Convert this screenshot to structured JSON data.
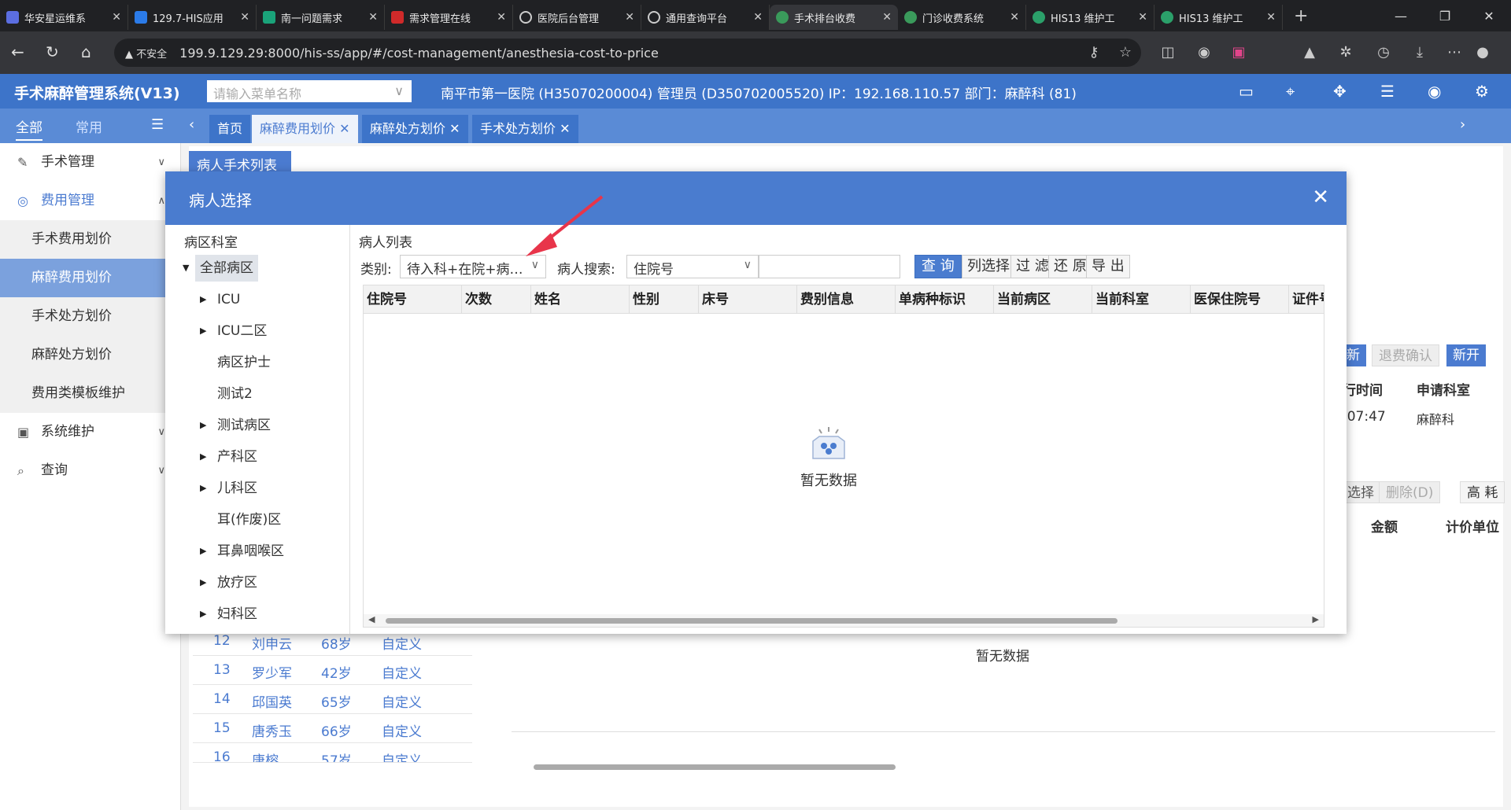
{
  "browser": {
    "tabs": [
      {
        "label": "华安星运维系",
        "color": "#5b6ee1"
      },
      {
        "label": "129.7-HIS应用",
        "color": "#2b7be8"
      },
      {
        "label": "南一问题需求",
        "color": "#1aa37a"
      },
      {
        "label": "需求管理在线",
        "color": "#d02a2a"
      },
      {
        "label": "医院后台管理",
        "color": "#888888"
      },
      {
        "label": "通用查询平台",
        "color": "#888888"
      },
      {
        "label": "手术排台收费",
        "color": "#3a9a5b"
      },
      {
        "label": "门诊收费系统",
        "color": "#3a9a5b"
      },
      {
        "label": "HIS13 维护工",
        "color": "#2ba06a"
      },
      {
        "label": "HIS13 维护工",
        "color": "#2ba06a"
      }
    ],
    "security": "不安全",
    "url": "199.9.129.29:8000/his-ss/app/#/cost-management/anesthesia-cost-to-price"
  },
  "app": {
    "title": "手术麻醉管理系统(V13)",
    "menu_search_placeholder": "请输入菜单名称",
    "hospital_info": "南平市第一医院 (H35070200004) 管理员 (D350702005520) IP：192.168.110.57 部门：麻醉科 (81)"
  },
  "sidebar": {
    "tab_all": "全部",
    "tab_common": "常用",
    "items": [
      {
        "label": "手术管理"
      },
      {
        "label": "费用管理"
      },
      {
        "label": "手术费用划价"
      },
      {
        "label": "麻醉费用划价"
      },
      {
        "label": "手术处方划价"
      },
      {
        "label": "麻醉处方划价"
      },
      {
        "label": "费用类模板维护"
      },
      {
        "label": "系统维护"
      },
      {
        "label": "查询"
      }
    ]
  },
  "tabs": [
    {
      "label": "首页"
    },
    {
      "label": "麻醉费用划价"
    },
    {
      "label": "麻醉处方划价"
    },
    {
      "label": "手术处方划价"
    }
  ],
  "background": {
    "patient_list_title": "病人手术列表",
    "btn_refund_confirm": "退费确认",
    "btn_new": "新开",
    "btn_new_partial": "新",
    "col_exec_time": "行时间",
    "col_apply_dept": "申请科室",
    "time_value": ":07:47",
    "dept_value": "麻醉科",
    "btn_select_partial": "选择",
    "btn_delete": "删除(D)",
    "btn_high": "高 耗",
    "col_amount": "金额",
    "col_unit": "计价单位",
    "empty_text": "暂无数据",
    "rows": [
      {
        "no": "12",
        "name": "刘申云",
        "age": "68岁",
        "type": "自定义"
      },
      {
        "no": "13",
        "name": "罗少军",
        "age": "42岁",
        "type": "自定义"
      },
      {
        "no": "14",
        "name": "邱国英",
        "age": "65岁",
        "type": "自定义"
      },
      {
        "no": "15",
        "name": "唐秀玉",
        "age": "66岁",
        "type": "自定义"
      },
      {
        "no": "16",
        "name": "唐榕",
        "age": "57岁",
        "type": "自定义"
      }
    ]
  },
  "modal": {
    "title": "病人选择",
    "left_title": "病区科室",
    "tree": [
      {
        "label": "全部病区",
        "expanded": true,
        "selected": true
      },
      {
        "label": "ICU",
        "children": true
      },
      {
        "label": "ICU二区",
        "children": true
      },
      {
        "label": "病区护士",
        "children": false
      },
      {
        "label": "测试2",
        "children": false
      },
      {
        "label": "测试病区",
        "children": true
      },
      {
        "label": "产科区",
        "children": true
      },
      {
        "label": "儿科区",
        "children": true
      },
      {
        "label": "耳(作废)区",
        "children": false
      },
      {
        "label": "耳鼻咽喉区",
        "children": true
      },
      {
        "label": "放疗区",
        "children": true
      },
      {
        "label": "妇科区",
        "children": true
      }
    ],
    "right_title": "病人列表",
    "filter": {
      "category_label": "类别:",
      "category_value": "待入科+在院+病…",
      "search_label": "病人搜索:",
      "search_type": "住院号",
      "search_value": "",
      "query": "查 询",
      "col_select": "列选择",
      "filter": "过 滤",
      "restore": "还 原",
      "export": "导 出"
    },
    "columns": [
      "住院号",
      "次数",
      "姓名",
      "性别",
      "床号",
      "费别信息",
      "单病种标识",
      "当前病区",
      "当前科室",
      "医保住院号",
      "证件号"
    ],
    "empty_text": "暂无数据"
  }
}
